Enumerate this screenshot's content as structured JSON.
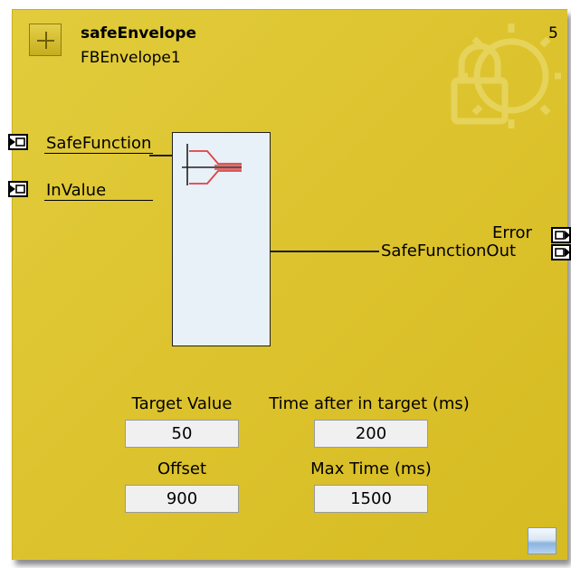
{
  "block": {
    "type_name": "safeEnvelope",
    "instance_name": "FBEnvelope1",
    "execution_order": "5"
  },
  "inputs": [
    {
      "label": "SafeFunction",
      "icon": "input-pin-icon"
    },
    {
      "label": "InValue",
      "icon": "input-pin-icon"
    }
  ],
  "outputs": [
    {
      "label": "Error",
      "icon": "output-pin-icon"
    },
    {
      "label": "SafeFunctionOut",
      "icon": "output-pin-icon"
    }
  ],
  "params": {
    "target_value": {
      "label": "Target Value",
      "value": "50"
    },
    "time_after_in_target": {
      "label": "Time after in target (ms)",
      "value": "200"
    },
    "offset": {
      "label": "Offset",
      "value": "900"
    },
    "max_time": {
      "label": "Max Time (ms)",
      "value": "1500"
    }
  },
  "icons": {
    "expand": "plus-icon",
    "watermark": "safety-lock-gear-icon",
    "function": "envelope-function-icon",
    "corner": "resize-icon"
  },
  "colors": {
    "block_background": "#dcc22c",
    "function_box": "#e8f0f8",
    "curve_red": "#e04040"
  }
}
